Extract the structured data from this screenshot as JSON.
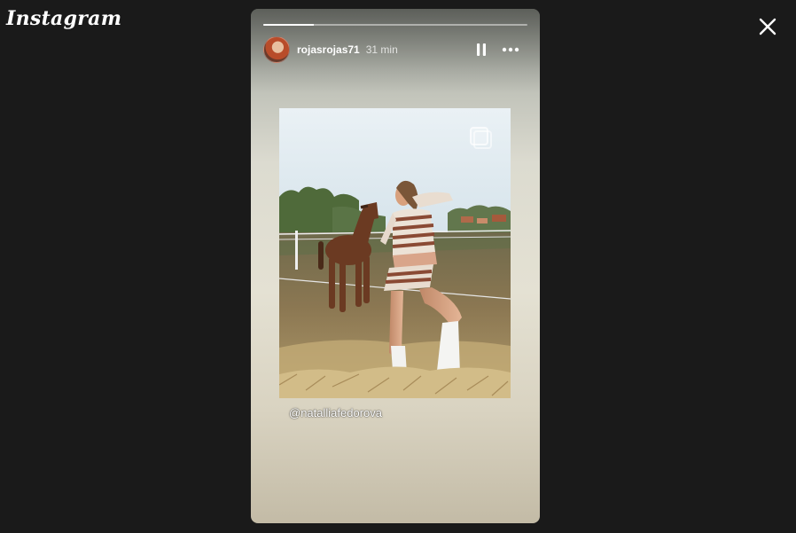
{
  "app": {
    "logo_text": "Instagram"
  },
  "story": {
    "username": "rojasrojas71",
    "timestamp": "31 min",
    "progress_fraction": 0.19,
    "mention": "@natalliafedorova"
  },
  "icons": {
    "close": "close-icon",
    "pause": "pause-icon",
    "more": "more-horizontal-icon",
    "multi_post": "multiple-images-icon"
  },
  "colors": {
    "page_background": "#1a1a1a",
    "text_primary": "#ffffff"
  }
}
